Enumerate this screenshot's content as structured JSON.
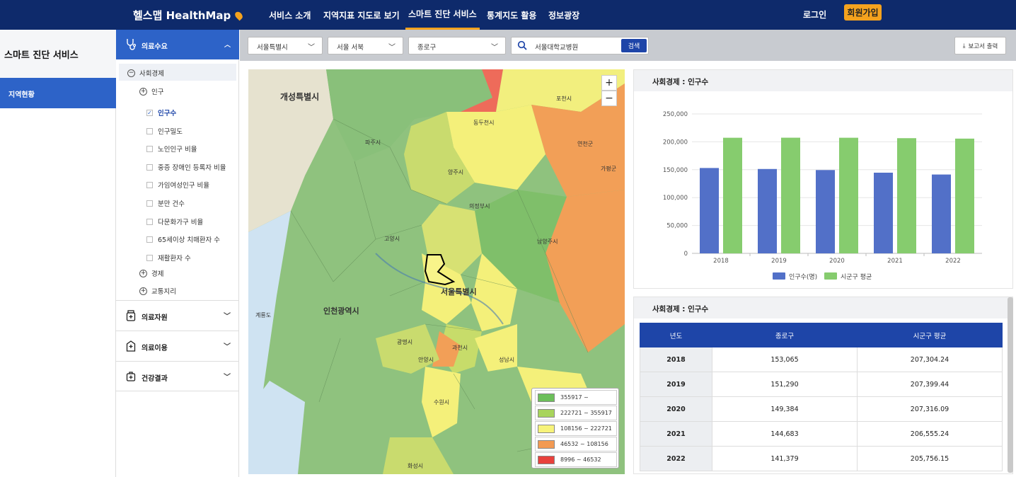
{
  "header": {
    "logo": "헬스맵 HealthMap",
    "menu": [
      "서비스 소개",
      "지역지표 지도로 보기",
      "스마트 진단 서비스",
      "통계지도 활용",
      "정보광장"
    ],
    "active_menu": "스마트 진단 서비스",
    "login": "로그인",
    "join": "회원가입"
  },
  "sidebar": {
    "title": "스마트 진단 서비스",
    "active_item": "지역현황"
  },
  "tree": {
    "section": "의료수요",
    "group": "사회경제",
    "subgroup": "인구",
    "items": [
      {
        "label": "인구수",
        "checked": true
      },
      {
        "label": "인구밀도",
        "checked": false
      },
      {
        "label": "노인인구 비율",
        "checked": false
      },
      {
        "label": "중증 장애인 등록자 비율",
        "checked": false
      },
      {
        "label": "가임여성인구 비율",
        "checked": false
      },
      {
        "label": "분만 건수",
        "checked": false
      },
      {
        "label": "다문화가구 비율",
        "checked": false
      },
      {
        "label": "65세이상 치매환자 수",
        "checked": false
      },
      {
        "label": "재활환자 수",
        "checked": false
      }
    ],
    "other_groups": [
      "경제",
      "교통지리"
    ],
    "accordions": [
      "의료자원",
      "의료이용",
      "건강결과"
    ]
  },
  "toolbar": {
    "region1": "서울특별시",
    "region2": "서울 서북",
    "region3": "종로구",
    "search_value": "서울대학교병원",
    "search_button": "검색",
    "report_button": "보고서 출력"
  },
  "map": {
    "zoom_in": "+",
    "zoom_out": "−",
    "labels": [
      "개성특별시",
      "파주시",
      "양주시",
      "포천시",
      "동두천시",
      "의정부시",
      "고양시",
      "남양주시",
      "서울특별시",
      "인천광역시",
      "가평군",
      "과천시",
      "성남시",
      "화성시",
      "계룡도",
      "광명시",
      "안양시",
      "수원시",
      "연천군"
    ],
    "legend": [
      {
        "range": "355917 ~",
        "color": "#6cbf5a"
      },
      {
        "range": "222721 ~ 355917",
        "color": "#a8d45c"
      },
      {
        "range": "108156 ~ 222721",
        "color": "#f7f37a"
      },
      {
        "range": "46532 ~ 108156",
        "color": "#f29a53"
      },
      {
        "range": "8996 ~ 46532",
        "color": "#e8413c"
      }
    ]
  },
  "chart_panel": {
    "title": "사회경제 : 인구수"
  },
  "table_panel": {
    "title": "사회경제 : 인구수",
    "headers": [
      "년도",
      "종로구",
      "시군구 평균"
    ],
    "rows": [
      [
        "2018",
        "153,065",
        "207,304.24"
      ],
      [
        "2019",
        "151,290",
        "207,399.44"
      ],
      [
        "2020",
        "149,384",
        "207,316.09"
      ],
      [
        "2021",
        "144,683",
        "206,555.24"
      ],
      [
        "2022",
        "141,379",
        "205,756.15"
      ]
    ]
  },
  "chart_data": {
    "type": "bar",
    "title": "",
    "categories": [
      "2018",
      "2019",
      "2020",
      "2021",
      "2022"
    ],
    "series": [
      {
        "name": "인구수(명)",
        "values": [
          153065,
          151290,
          149384,
          144683,
          141379
        ],
        "color": "#5270c8"
      },
      {
        "name": "시군구 평균",
        "values": [
          207304.24,
          207399.44,
          207316.09,
          206555.24,
          205756.15
        ],
        "color": "#86cc6e"
      }
    ],
    "y_ticks": [
      "0",
      "50,000",
      "100,000",
      "150,000",
      "200,000",
      "250,000"
    ],
    "ylim": [
      0,
      250000
    ],
    "grid": true,
    "legend_position": "bottom"
  }
}
